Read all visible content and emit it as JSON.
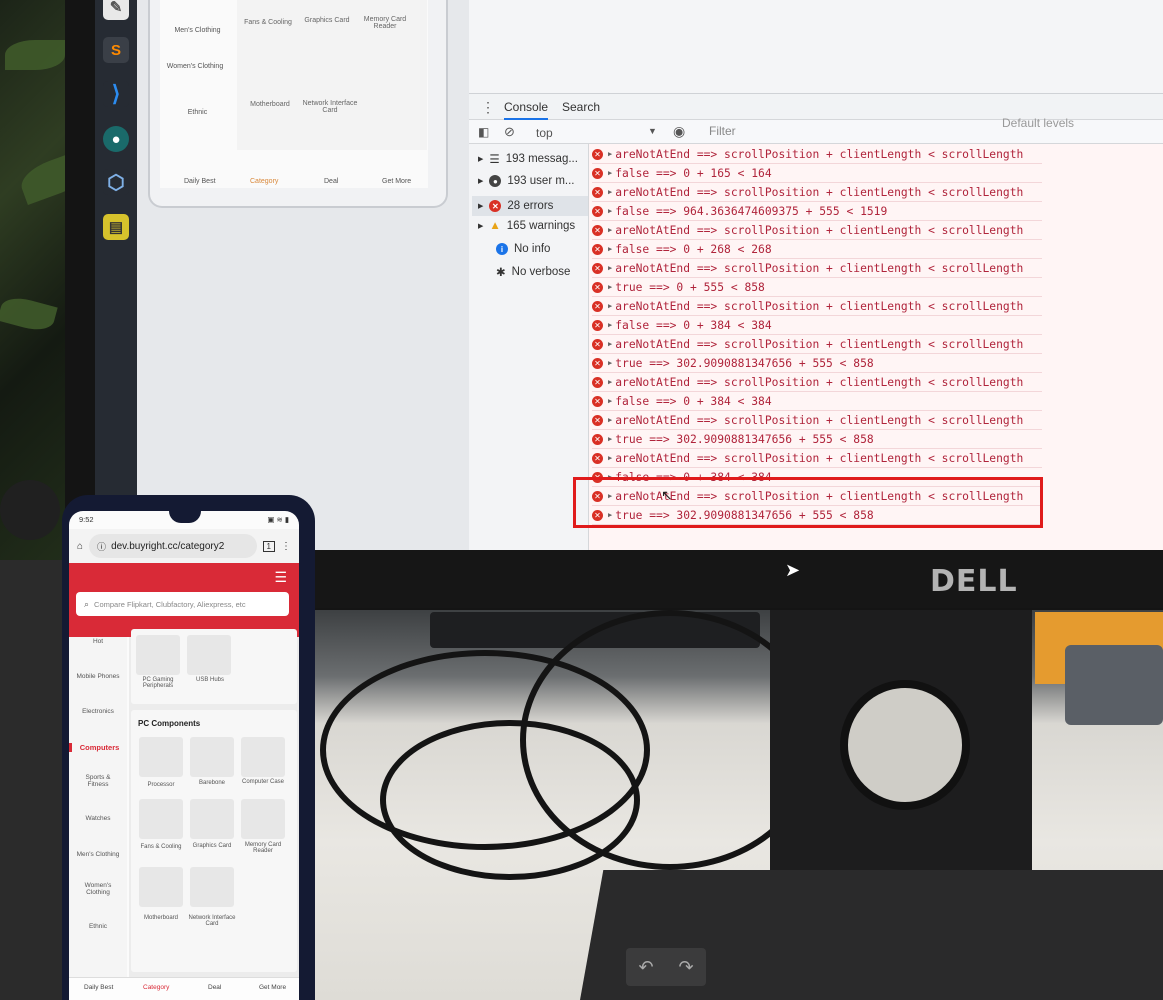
{
  "devtools": {
    "tabs": [
      "Console",
      "Search"
    ],
    "context": "top",
    "filter_placeholder": "Filter",
    "levels": "Default levels",
    "sidebar": [
      {
        "label": "193 messag...",
        "icon": "list-icon"
      },
      {
        "label": "193 user m...",
        "icon": "user-icon"
      },
      {
        "label": "28 errors",
        "icon": "error-icon"
      },
      {
        "label": "165 warnings",
        "icon": "warning-icon"
      },
      {
        "label": "No info",
        "icon": "info-icon"
      },
      {
        "label": "No verbose",
        "icon": "bug-icon"
      }
    ],
    "log_lines": [
      "areNotAtEnd ==> scrollPosition + clientLength < scrollLength",
      "false ==> 0 + 165 < 164",
      "areNotAtEnd ==> scrollPosition + clientLength < scrollLength",
      "false ==> 964.3636474609375 + 555 < 1519",
      "areNotAtEnd ==> scrollPosition + clientLength < scrollLength",
      "false ==> 0 + 268 < 268",
      "areNotAtEnd ==> scrollPosition + clientLength < scrollLength",
      "true ==> 0 + 555 < 858",
      "areNotAtEnd ==> scrollPosition + clientLength < scrollLength",
      "false ==> 0 + 384 < 384",
      "areNotAtEnd ==> scrollPosition + clientLength < scrollLength",
      "true ==> 302.9090881347656 + 555 < 858",
      "areNotAtEnd ==> scrollPosition + clientLength < scrollLength",
      "false ==> 0 + 384 < 384",
      "areNotAtEnd ==> scrollPosition + clientLength < scrollLength",
      "true ==> 302.9090881347656 + 555 < 858",
      "areNotAtEnd ==> scrollPosition + clientLength < scrollLength",
      "false ==> 0 + 384 < 384",
      "areNotAtEnd ==> scrollPosition + clientLength < scrollLength",
      "true ==> 302.9090881347656 + 555 < 858"
    ]
  },
  "monitor_preview": {
    "categories": [
      "Men's Clothing",
      "Women's Clothing",
      "Ethnic"
    ],
    "items": [
      "Fans & Cooling",
      "Graphics Card",
      "Memory Card Reader",
      "Motherboard",
      "Network Interface Card"
    ],
    "nav": [
      "Daily Best",
      "Category",
      "Deal",
      "Get More"
    ]
  },
  "monitor_brand": "DELL",
  "phone": {
    "time": "9:52",
    "url": "dev.buyright.cc/category2",
    "tab_count": "1",
    "search_placeholder": "Compare Flipkart, Clubfactory, Aliexpress, etc",
    "categories": [
      "Hot",
      "Mobile Phones",
      "Electronics",
      "Computers",
      "Sports & Fitness",
      "Watches",
      "Men's Clothing",
      "Women's Clothing",
      "Ethnic"
    ],
    "top_items": [
      "PC Gaming Peripherals",
      "USB Hubs"
    ],
    "section_title": "PC Components",
    "section_items": [
      "Processor",
      "Barebone",
      "Computer Case",
      "Fans & Cooling",
      "Graphics Card",
      "Memory Card Reader",
      "Motherboard",
      "Network Interface Card"
    ],
    "nav": [
      "Daily Best",
      "Category",
      "Deal",
      "Get More"
    ]
  },
  "colors": {
    "brand_red": "#d92a37",
    "error_red": "#b0243b",
    "highlight": "#e01b1b"
  }
}
